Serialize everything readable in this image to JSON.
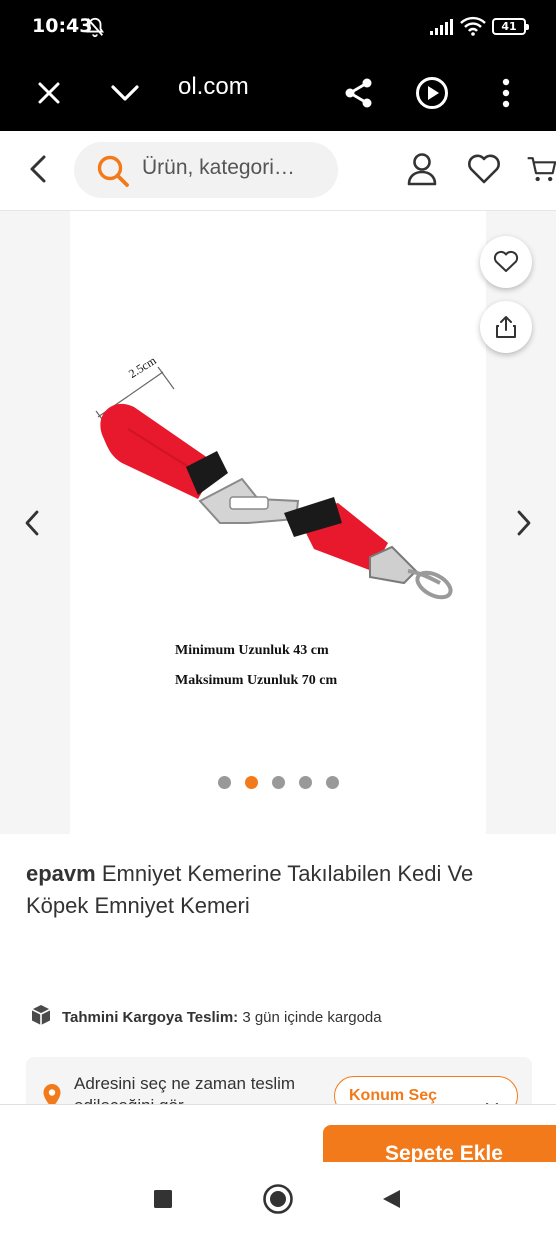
{
  "status_bar": {
    "time": "10:43",
    "battery": "41"
  },
  "browser": {
    "url": "ol.com"
  },
  "header": {
    "search_placeholder": "Ürün, kategori…"
  },
  "gallery": {
    "caption_min": "Minimum Uzunluk 43 cm",
    "caption_max": "Maksimum Uzunluk 70 cm",
    "dimension_label": "2.5cm",
    "active_index": 1,
    "total": 5
  },
  "product": {
    "brand": "epavm",
    "title": " Emniyet Kemerine Takılabilen Kedi Ve Köpek Emniyet Kemeri"
  },
  "shipping": {
    "label": "Tahmini Kargoya Teslim:",
    "value": " 3 gün içinde kargoda"
  },
  "location": {
    "text": "Adresini seç ne zaman teslim edileceğini gör",
    "button": "Konum Seç"
  },
  "cart": {
    "button": "Sepete Ekle"
  },
  "colors": {
    "accent": "#f27a1a",
    "product_red": "#e8192c"
  }
}
